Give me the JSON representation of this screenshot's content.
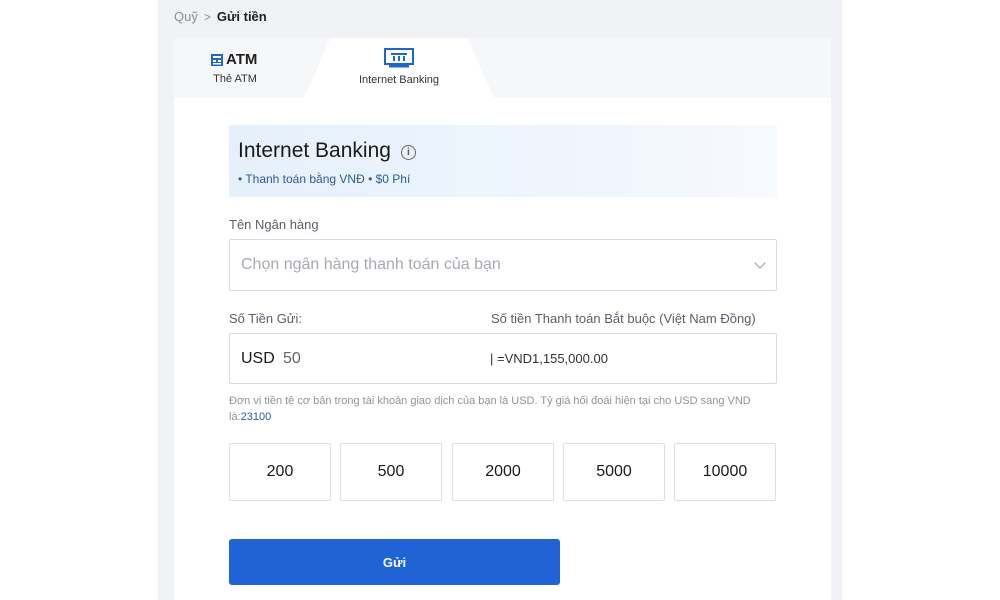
{
  "breadcrumb": {
    "parent": "Quỹ",
    "separator": ">",
    "current": "Gửi tiền"
  },
  "tabs": [
    {
      "title": "ATM",
      "subtitle": "Thẻ ATM",
      "icon": "atm-card-icon"
    },
    {
      "subtitle": "Internet Banking",
      "icon": "bank-building-icon",
      "active": true
    }
  ],
  "hero": {
    "title": "Internet Banking",
    "subtitle": "• Thanh toán bằng VNĐ • $0 Phí",
    "info_icon": "info-icon"
  },
  "bank_field": {
    "label": "Tên Ngân hàng",
    "placeholder": "Chọn ngân hàng thanh toán của bạn"
  },
  "amount_field": {
    "label": "Số Tiền Gửi:",
    "currency": "USD",
    "value": "50"
  },
  "converted_field": {
    "label": "Số tiền Thanh toán Bắt buộc (Việt Nam Đồng)",
    "value": "| =VND1,155,000.00"
  },
  "note": {
    "text": "Đơn vị tiền tệ cơ bản trong tài khoản giao dịch của bạn là USD. Tỷ giá hối đoái hiện tại cho USD sang VND là:",
    "rate": "23100"
  },
  "quick_amounts": [
    "200",
    "500",
    "2000",
    "5000",
    "10000"
  ],
  "submit_label": "Gửi",
  "colors": {
    "accent": "#1f63d6",
    "link": "#2a5c9a",
    "panel_bg": "#f1f2f5"
  }
}
